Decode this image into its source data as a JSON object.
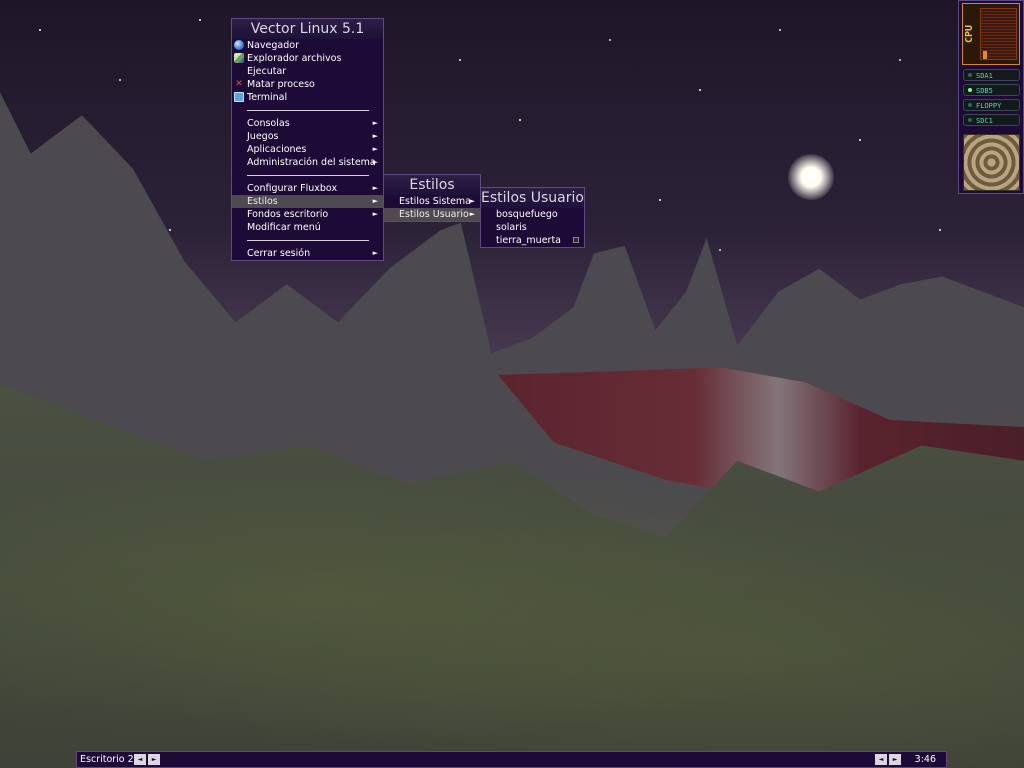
{
  "main_menu": {
    "title": "Vector Linux 5.1",
    "items": [
      {
        "label": "Navegador",
        "icon": "globe-icon",
        "type": "item"
      },
      {
        "label": "Explorador archivos",
        "icon": "file-manager-icon",
        "type": "item"
      },
      {
        "label": "Ejecutar",
        "icon": "",
        "type": "item"
      },
      {
        "label": "Matar proceso",
        "icon": "kill-icon",
        "type": "item"
      },
      {
        "label": "Terminal",
        "icon": "terminal-icon",
        "type": "item"
      },
      {
        "type": "separator"
      },
      {
        "label": "Consolas",
        "type": "submenu"
      },
      {
        "label": "Juegos",
        "type": "submenu"
      },
      {
        "label": "Aplicaciones",
        "type": "submenu"
      },
      {
        "label": "Administración del sistema",
        "type": "submenu"
      },
      {
        "type": "separator"
      },
      {
        "label": "Configurar Fluxbox",
        "type": "submenu"
      },
      {
        "label": "Estilos",
        "type": "submenu",
        "active": true
      },
      {
        "label": "Fondos escritorio",
        "type": "submenu"
      },
      {
        "label": "Modificar menú",
        "type": "item"
      },
      {
        "type": "separator"
      },
      {
        "label": "Cerrar sesión",
        "type": "submenu"
      }
    ]
  },
  "styles_menu": {
    "title": "Estilos",
    "items": [
      {
        "label": "Estilos Sistema",
        "type": "submenu"
      },
      {
        "label": "Estilos Usuario",
        "type": "submenu",
        "active": true
      }
    ]
  },
  "user_styles_menu": {
    "title": "Estilos Usuario",
    "items": [
      {
        "label": "bosquefuego",
        "selected": false
      },
      {
        "label": "solaris",
        "selected": false
      },
      {
        "label": "tierra_muerta",
        "selected": true
      }
    ]
  },
  "slit": {
    "cpu_label": "CPU",
    "drives": [
      {
        "label": "SDA1",
        "led_on": false
      },
      {
        "label": "SDB5",
        "led_on": true
      },
      {
        "label": "FLOPPY",
        "led_on": false
      },
      {
        "label": "SDC1",
        "led_on": false
      }
    ]
  },
  "toolbar": {
    "workspace": "Escritorio 2",
    "prev_symbol": "◄",
    "next_symbol": "►",
    "clock": "3:46"
  },
  "colors": {
    "menu_bg": "#1d0a36",
    "menu_border": "#5e4a80",
    "highlight": "#4e4a50",
    "cpu_accent": "#e88a20",
    "drive_text": "#4fd8b0"
  }
}
